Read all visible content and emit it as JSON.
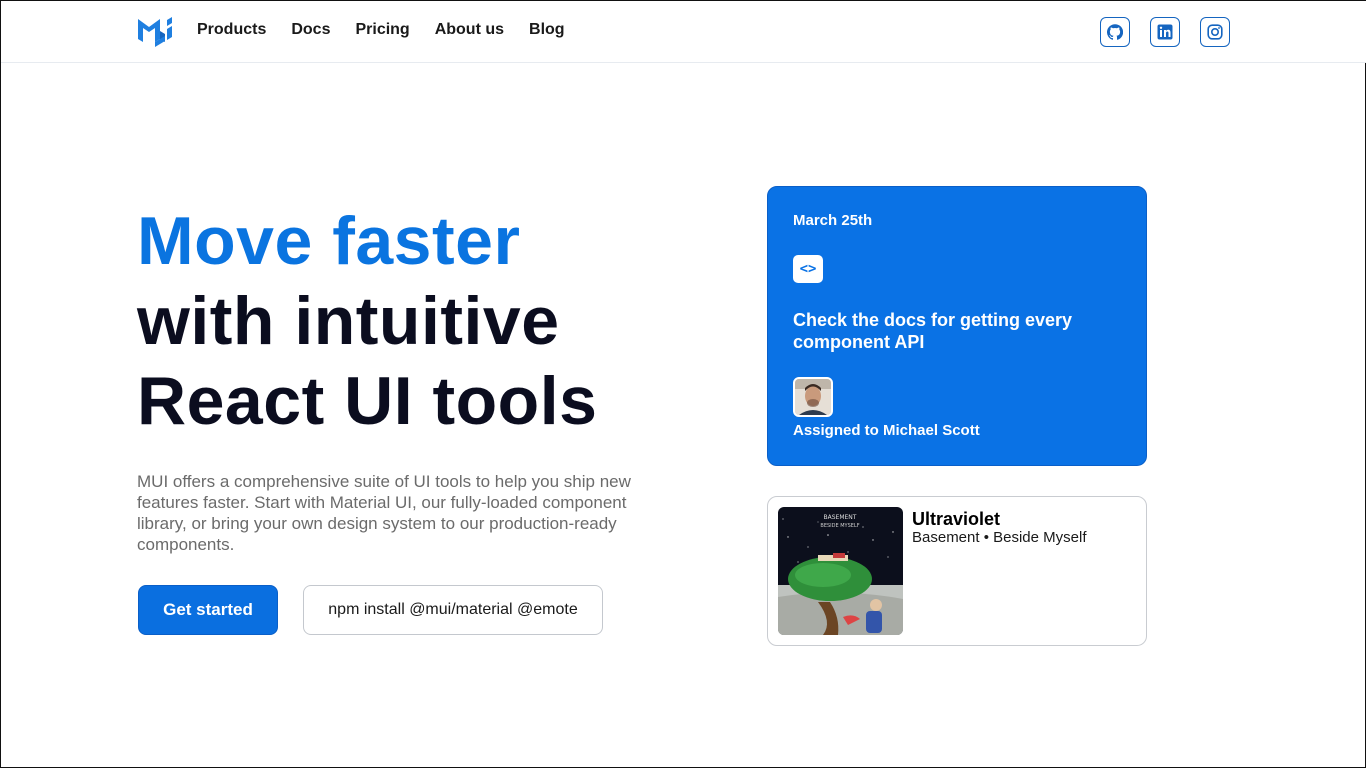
{
  "header": {
    "nav": [
      "Products",
      "Docs",
      "Pricing",
      "About us",
      "Blog"
    ],
    "brand_color": "#1976d2"
  },
  "hero": {
    "title_line1": "Move faster",
    "title_line2": "with intuitive",
    "title_line3": "React UI tools",
    "description": "MUI offers a comprehensive suite of UI tools to help you ship new features faster. Start with Material UI, our fully-loaded component library, or bring your own design system to our production-ready components.",
    "cta_label": "Get started",
    "npm_command": "npm install @mui/material @emote",
    "accent_color": "#0a74e0"
  },
  "task_card": {
    "date": "March 25th",
    "badge": "<>",
    "text": "Check the docs for getting every component API",
    "assigned": "Assigned to Michael Scott"
  },
  "player_card": {
    "title": "Ultraviolet",
    "subtitle": "Basement • Beside Myself",
    "album_art_text_1": "BASEMENT",
    "album_art_text_2": "BESIDE MYSELF"
  },
  "icons": [
    "mui-logo-icon",
    "github-icon",
    "linkedin-icon",
    "instagram-icon"
  ]
}
